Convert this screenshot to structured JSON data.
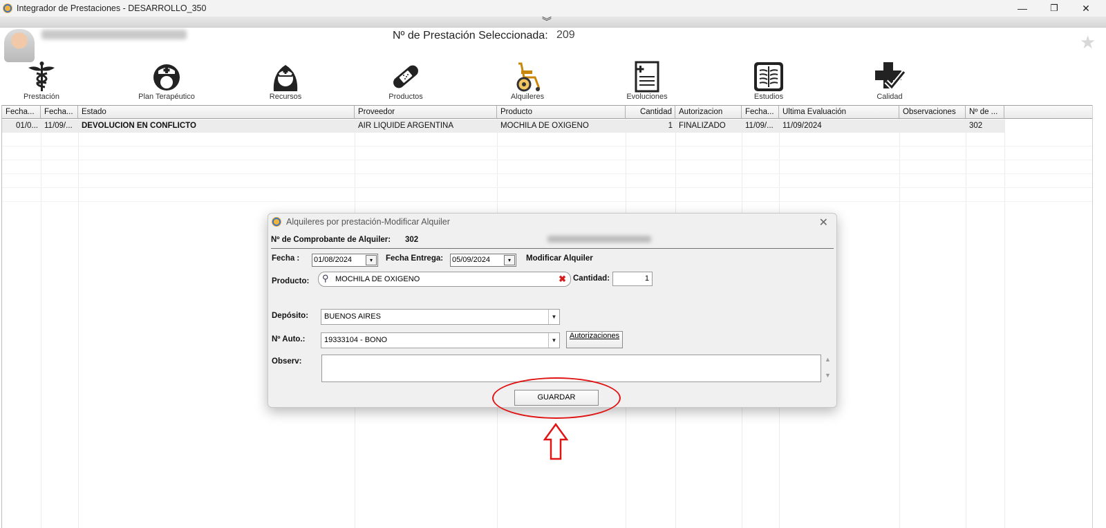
{
  "window": {
    "title": "Integrador de Prestaciones - DESARROLLO_350",
    "minimize": "—",
    "restore": "❐",
    "close": "✕"
  },
  "header": {
    "selected_label": "Nº de Prestación Seleccionada:",
    "selected_value": "209",
    "collapse_glyph": "︾"
  },
  "nav": [
    {
      "label": "Prestación",
      "icon": "caduceus-icon"
    },
    {
      "label": "Plan Terapéutico",
      "icon": "nurse-head-icon"
    },
    {
      "label": "Recursos",
      "icon": "nurse-icon"
    },
    {
      "label": "Productos",
      "icon": "bandage-icon"
    },
    {
      "label": "Alquileres",
      "icon": "wheelchair-icon"
    },
    {
      "label": "Evoluciones",
      "icon": "medical-report-icon"
    },
    {
      "label": "Estudios",
      "icon": "xray-icon"
    },
    {
      "label": "Calidad",
      "icon": "cross-check-icon"
    }
  ],
  "table": {
    "columns": [
      "Fecha...",
      "Fecha...",
      "Estado",
      "Proveedor",
      "Producto",
      "Cantidad",
      "Autorizacion",
      "Fecha...",
      "Ultima Evaluación",
      "Observaciones",
      "Nº de ..."
    ],
    "rows": [
      [
        "01/0...",
        "11/09/...",
        "DEVOLUCION EN CONFLICTO",
        "AIR LIQUIDE ARGENTINA",
        "MOCHILA DE OXIGENO",
        "1",
        "FINALIZADO",
        "11/09/...",
        "11/09/2024",
        "",
        "302"
      ]
    ]
  },
  "dialog": {
    "title": "Alquileres por prestación-Modificar Alquiler",
    "comprobante_label": "Nº de Comprobante de Alquiler:",
    "comprobante_value": "302",
    "fecha_label": "Fecha :",
    "fecha_value": "01/08/2024",
    "fecha_entrega_label": "Fecha Entrega:",
    "fecha_entrega_value": "05/09/2024",
    "mode_label": "Modificar Alquiler",
    "producto_label": "Producto:",
    "producto_value": "MOCHILA DE OXIGENO",
    "cantidad_label": "Cantidad:",
    "cantidad_value": "1",
    "deposito_label": "Depósito:",
    "deposito_value": "BUENOS AIRES",
    "auto_label": "Nº Auto.:",
    "auto_value": "19333104 - BONO",
    "autorizaciones_button": "Autorizaciones",
    "observ_label": "Observ:",
    "observ_value": "",
    "guardar_button": "GUARDAR"
  },
  "colors": {
    "annotation": "#e01414",
    "selected_row": "#ececec"
  }
}
